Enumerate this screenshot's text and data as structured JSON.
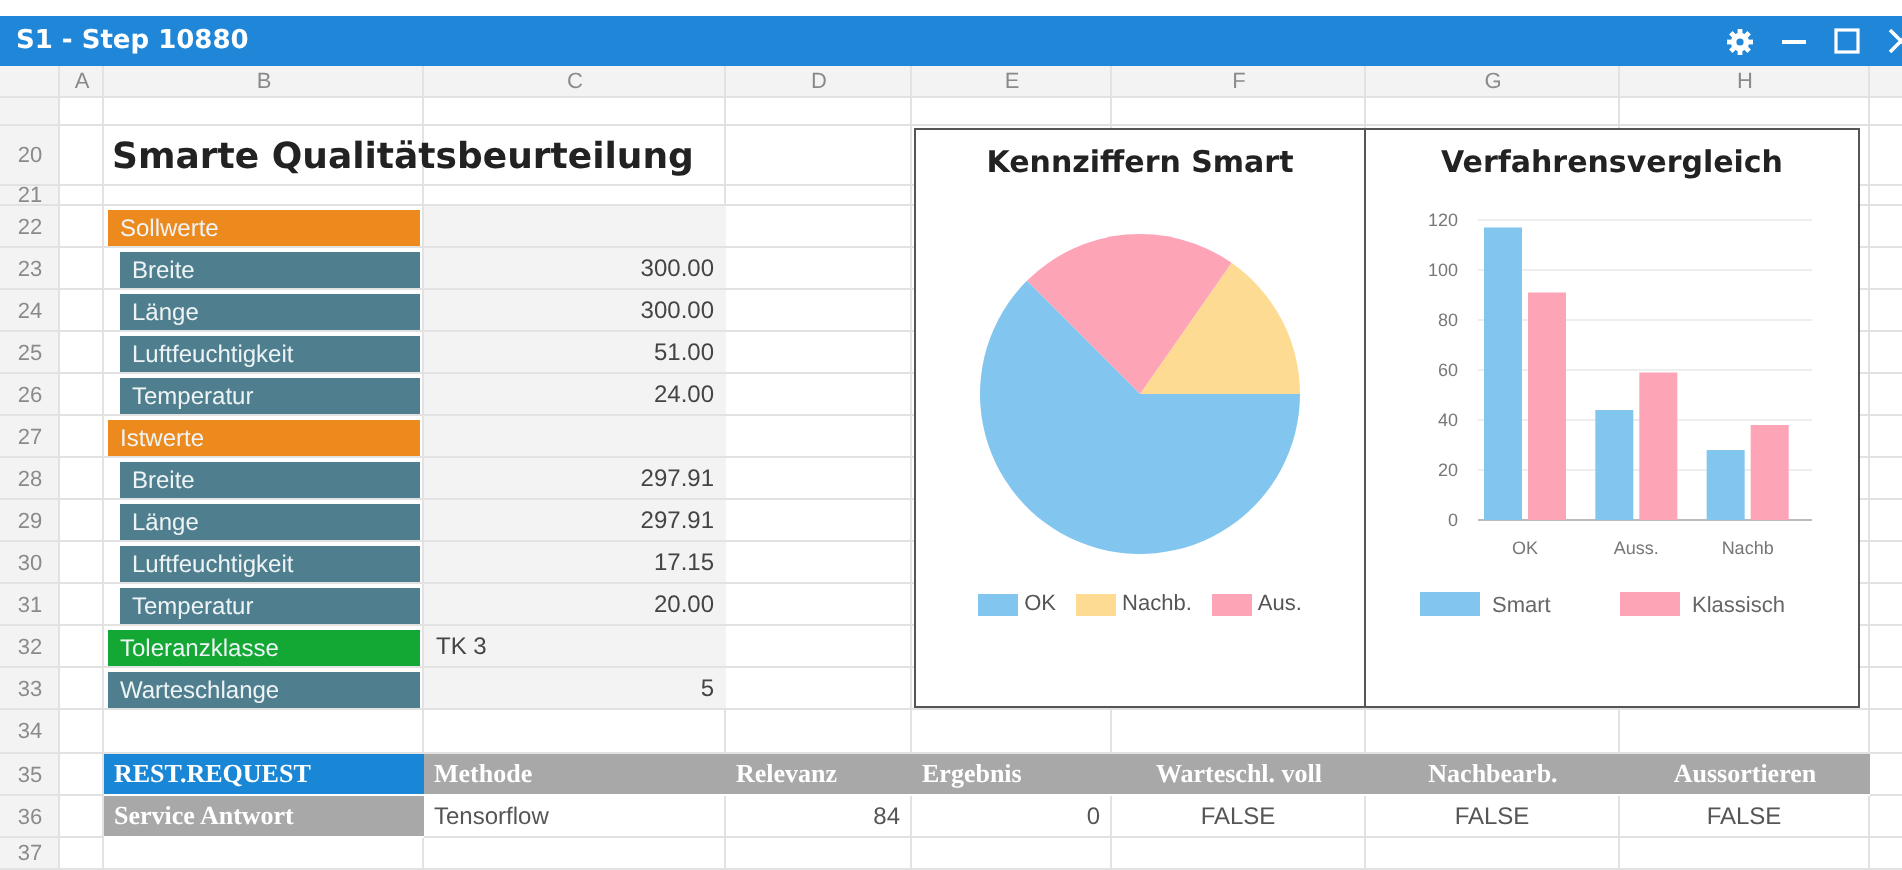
{
  "window": {
    "title": "S1 - Step 10880"
  },
  "column_headers": [
    "A",
    "B",
    "C",
    "D",
    "E",
    "F",
    "G",
    "H"
  ],
  "row_numbers": [
    "20",
    "21",
    "22",
    "23",
    "24",
    "25",
    "26",
    "27",
    "28",
    "29",
    "30",
    "31",
    "32",
    "33",
    "34",
    "35",
    "36",
    "37"
  ],
  "heading": "Smarte Qualitätsbeurteilung",
  "parameters": [
    {
      "kind": "group",
      "label": "Sollwerte"
    },
    {
      "kind": "item",
      "label": "Breite",
      "value": "300.00"
    },
    {
      "kind": "item",
      "label": "Länge",
      "value": "300.00"
    },
    {
      "kind": "item",
      "label": "Luftfeuchtigkeit",
      "value": "51.00"
    },
    {
      "kind": "item",
      "label": "Temperatur",
      "value": "24.00"
    },
    {
      "kind": "group",
      "label": "Istwerte"
    },
    {
      "kind": "item",
      "label": "Breite",
      "value": "297.91"
    },
    {
      "kind": "item",
      "label": "Länge",
      "value": "297.91"
    },
    {
      "kind": "item",
      "label": "Luftfeuchtigkeit",
      "value": "17.15"
    },
    {
      "kind": "item",
      "label": "Temperatur",
      "value": "20.00"
    },
    {
      "kind": "key",
      "label": "Toleranzklasse",
      "value": "TK 3"
    },
    {
      "kind": "field",
      "label": "Warteschlange",
      "value": "5"
    }
  ],
  "pie_chart": {
    "title": "Kennziffern Smart",
    "legend": [
      {
        "label": "OK",
        "color": "#82c5ef"
      },
      {
        "label": "Nachb.",
        "color": "#fddb93"
      },
      {
        "label": "Aus.",
        "color": "#fda4b6"
      }
    ]
  },
  "bar_chart": {
    "chart_data": {
      "type": "bar",
      "title": "Verfahrensvergleich",
      "categories": [
        "OK",
        "Auss.",
        "Nachb"
      ],
      "series": [
        {
          "name": "Smart",
          "color": "#82c5ef",
          "values": [
            117,
            44,
            28
          ]
        },
        {
          "name": "Klassisch",
          "color": "#fda4b6",
          "values": [
            91,
            59,
            38
          ]
        }
      ],
      "ylim": [
        0,
        120
      ],
      "yticks": [
        0,
        20,
        40,
        60,
        80,
        100,
        120
      ],
      "grid": true,
      "legend": true
    }
  },
  "request_table": {
    "rows": [
      [
        {
          "kind": "request",
          "text": "REST.REQUEST"
        },
        {
          "kind": "head",
          "text": "Methode"
        },
        {
          "kind": "head",
          "text": "Relevanz"
        },
        {
          "kind": "head",
          "text": "Ergebnis"
        },
        {
          "kind": "head",
          "text": "Warteschl. voll"
        },
        {
          "kind": "head",
          "text": "Nachbearb."
        },
        {
          "kind": "head",
          "text": "Aussortieren"
        }
      ],
      [
        {
          "kind": "head",
          "text": "Service Antwort"
        },
        {
          "kind": "value",
          "text": "Tensorflow"
        },
        {
          "kind": "value",
          "text": "84"
        },
        {
          "kind": "value",
          "text": "0"
        },
        {
          "kind": "value",
          "text": "FALSE"
        },
        {
          "kind": "value",
          "text": "FALSE"
        },
        {
          "kind": "value",
          "text": "FALSE"
        }
      ]
    ]
  }
}
